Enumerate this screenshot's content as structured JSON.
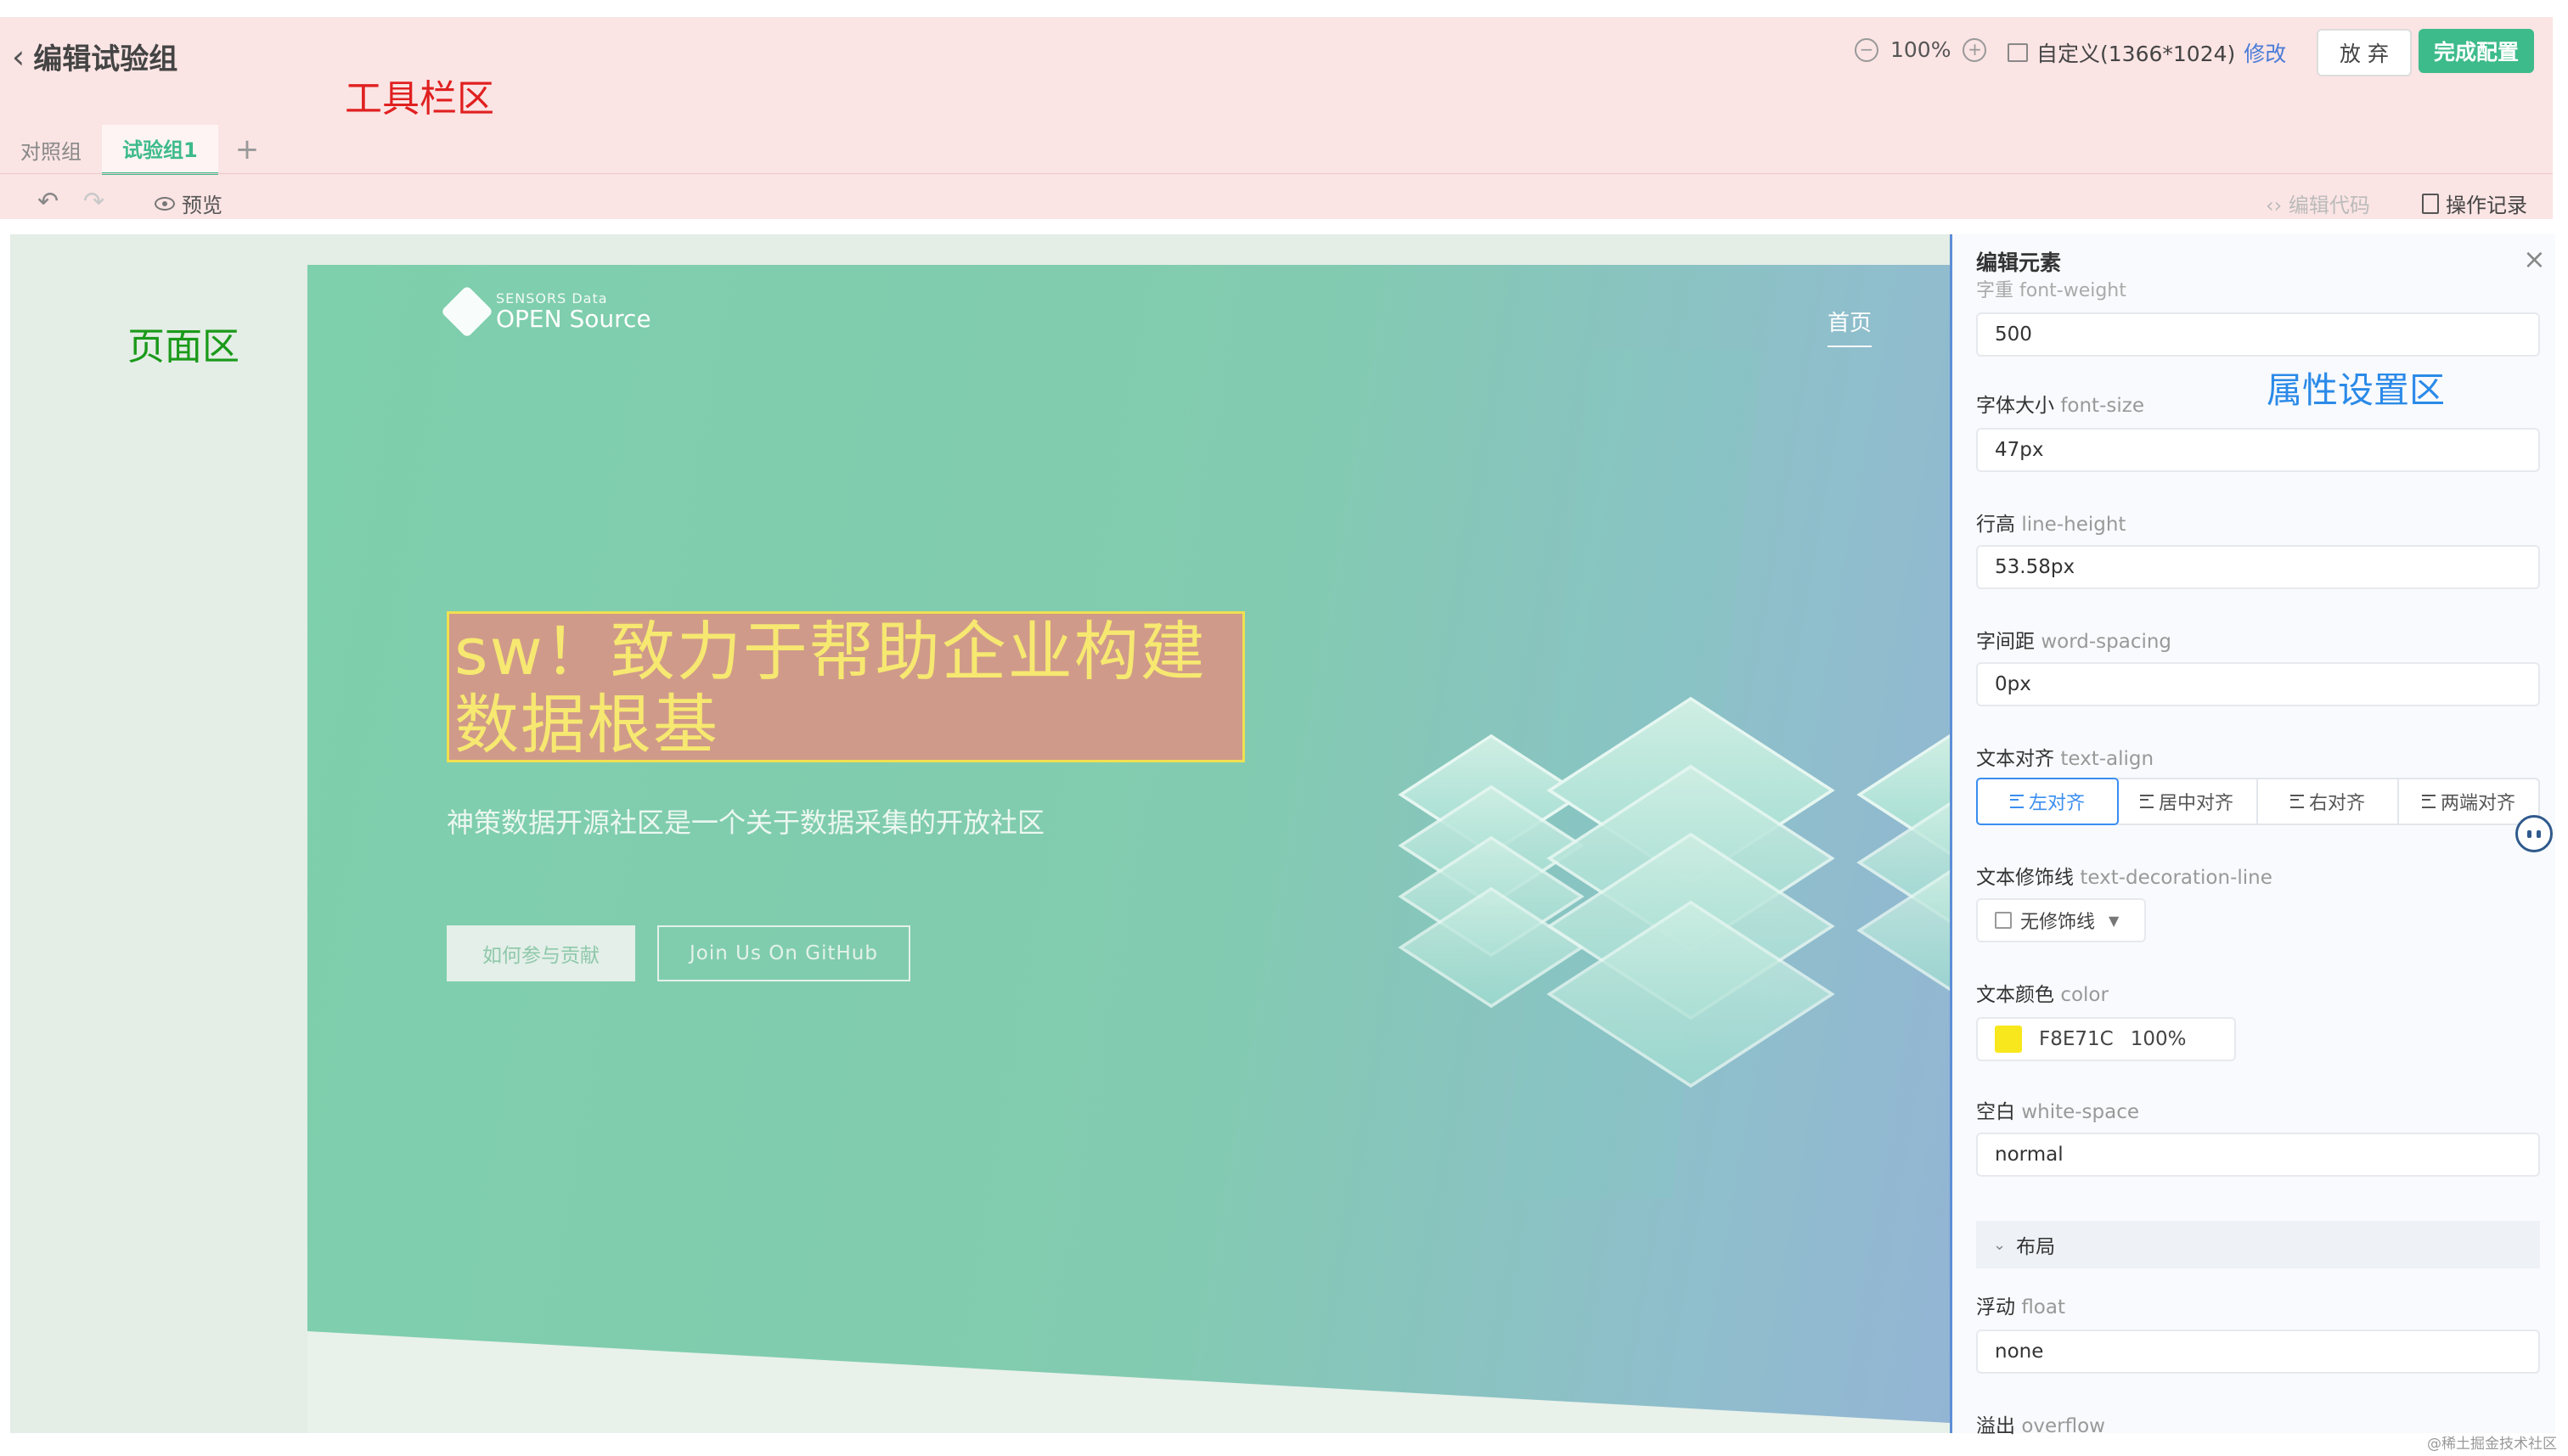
{
  "header": {
    "back_title": "编辑试验组",
    "zoom": "100%",
    "device_size": "自定义(1366*1024)",
    "modify_link": "修改",
    "discard_label": "放 弃",
    "done_label": "完成配置"
  },
  "zone_labels": {
    "toolbar": "工具栏区",
    "page": "页面区",
    "properties": "属性设置区"
  },
  "tabs": [
    {
      "label": "对照组",
      "active": false
    },
    {
      "label": "试验组1",
      "active": true
    }
  ],
  "subbar": {
    "preview_label": "预览",
    "edit_code_label": "编辑代码",
    "history_label": "操作记录"
  },
  "hero": {
    "logo_small": "SENSORS Data",
    "logo_big": "OPEN Source",
    "nav_home": "首页",
    "headline": "sw！致力于帮助企业构建数据根基",
    "subtitle": "神策数据开源社区是一个关于数据采集的开放社区",
    "btn_contribute": "如何参与贡献",
    "btn_github": "Join Us On GitHub"
  },
  "panel": {
    "title": "编辑元素",
    "cut_label": "字重 font-weight",
    "font_weight": {
      "value": "500"
    },
    "font_size": {
      "label": "字体大小",
      "prop": "font-size",
      "value": "47px"
    },
    "line_height": {
      "label": "行高",
      "prop": "line-height",
      "value": "53.58px"
    },
    "word_spacing": {
      "label": "字间距",
      "prop": "word-spacing",
      "value": "0px"
    },
    "text_align": {
      "label": "文本对齐",
      "prop": "text-align",
      "options": [
        "左对齐",
        "居中对齐",
        "右对齐",
        "两端对齐"
      ],
      "selected": "左对齐"
    },
    "text_decoration": {
      "label": "文本修饰线",
      "prop": "text-decoration-line",
      "value": "无修饰线"
    },
    "color": {
      "label": "文本颜色",
      "prop": "color",
      "hex": "F8E71C",
      "opacity": "100%",
      "swatch": "#F8E71C"
    },
    "white_space": {
      "label": "空白",
      "prop": "white-space",
      "value": "normal"
    },
    "layout_section": "布局",
    "float": {
      "label": "浮动",
      "prop": "float",
      "value": "none"
    },
    "overflow": {
      "label": "溢出",
      "prop": "overflow"
    }
  },
  "watermark": "@稀土掘金技术社区",
  "colors": {
    "accent": "#3dbb8b",
    "link": "#4a7cd8",
    "toolbar_zone": "#fbe4e4",
    "page_zone_label": "#1a9a1a",
    "toolbar_zone_label": "#e02020",
    "properties_zone_label": "#2b8ae8"
  }
}
